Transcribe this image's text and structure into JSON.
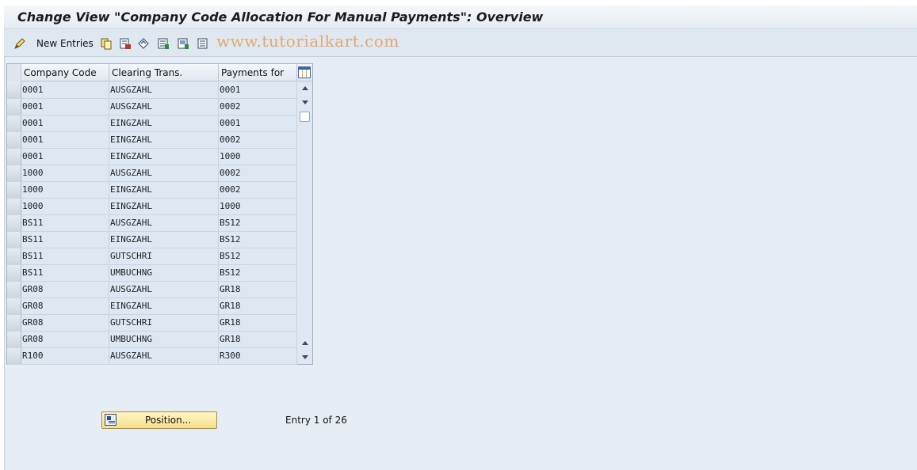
{
  "window": {
    "title": "Change View \"Company Code Allocation For Manual Payments\": Overview"
  },
  "toolbar": {
    "new_entries_label": "New Entries",
    "watermark": "www.tutorialkart.com",
    "icons": [
      "edit-pencil-icon",
      "copy-icon",
      "delete-icon",
      "undo-icon",
      "select-all-icon",
      "select-block-icon",
      "deselect-all-icon"
    ]
  },
  "table": {
    "columns": [
      "Company Code",
      "Clearing Trans.",
      "Payments for"
    ],
    "rows": [
      [
        "0001",
        "AUSGZAHL",
        "0001"
      ],
      [
        "0001",
        "AUSGZAHL",
        "0002"
      ],
      [
        "0001",
        "EINGZAHL",
        "0001"
      ],
      [
        "0001",
        "EINGZAHL",
        "0002"
      ],
      [
        "0001",
        "EINGZAHL",
        "1000"
      ],
      [
        "1000",
        "AUSGZAHL",
        "0002"
      ],
      [
        "1000",
        "EINGZAHL",
        "0002"
      ],
      [
        "1000",
        "EINGZAHL",
        "1000"
      ],
      [
        "BS11",
        "AUSGZAHL",
        "BS12"
      ],
      [
        "BS11",
        "EINGZAHL",
        "BS12"
      ],
      [
        "BS11",
        "GUTSCHRI",
        "BS12"
      ],
      [
        "BS11",
        "UMBUCHNG",
        "BS12"
      ],
      [
        "GR08",
        "AUSGZAHL",
        "GR18"
      ],
      [
        "GR08",
        "EINGZAHL",
        "GR18"
      ],
      [
        "GR08",
        "GUTSCHRI",
        "GR18"
      ],
      [
        "GR08",
        "UMBUCHNG",
        "GR18"
      ],
      [
        "R100",
        "AUSGZAHL",
        "R300"
      ]
    ]
  },
  "footer": {
    "position_button": "Position...",
    "entry_info": "Entry 1 of 26"
  }
}
